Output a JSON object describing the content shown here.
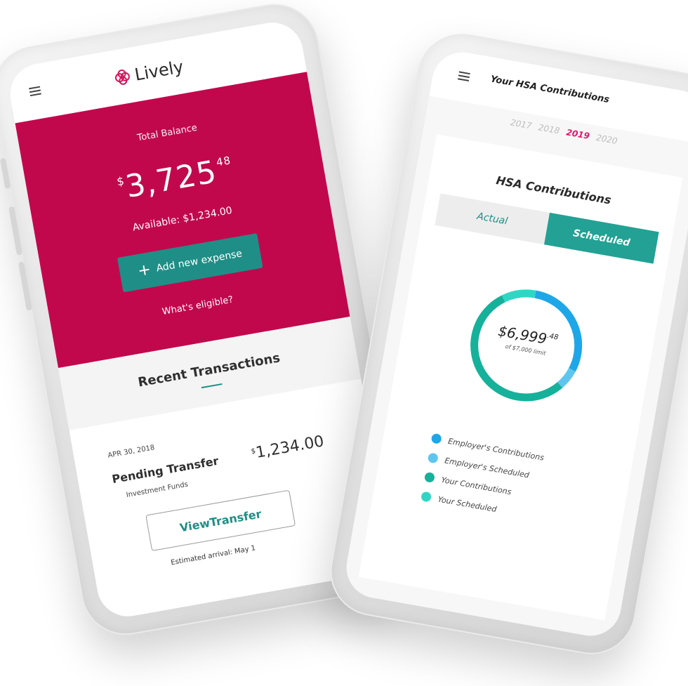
{
  "left_phone": {
    "logo_text": "Lively",
    "balance": {
      "label": "Total Balance",
      "currency": "$",
      "amount": "3,725",
      "cents": "48",
      "available": "Available: $1,234.00"
    },
    "add_expense_label": "Add new expense",
    "eligible_link": "What's eligible?",
    "recent_title": "Recent Transactions",
    "transaction": {
      "date": "APR 30, 2018",
      "name": "Pending Transfer",
      "sub": "Investment Funds",
      "currency": "$",
      "amount": "1,234.00",
      "button": "ViewTransfer",
      "eta": "Estimated arrival: May 1"
    }
  },
  "right_phone": {
    "title": "Your HSA Contributions",
    "years": [
      "2017",
      "2018",
      "2019",
      "2020"
    ],
    "active_year": "2019",
    "card_title": "HSA Contributions",
    "toggle": {
      "actual": "Actual",
      "scheduled": "Scheduled",
      "selected": "Scheduled"
    },
    "total": {
      "amount": "$6,999",
      "cents": ".48",
      "limit": "of $7,000 limit"
    },
    "donut_segments": [
      {
        "name": "Employer's Contributions",
        "fraction": 0.3,
        "color": "#1ea7e8"
      },
      {
        "name": "Employer's Scheduled",
        "fraction": 0.06,
        "color": "#5ec6ee"
      },
      {
        "name": "Your Contributions",
        "fraction": 0.54,
        "color": "#16b19a"
      },
      {
        "name": "Your Scheduled",
        "fraction": 0.1,
        "color": "#2fd6c4"
      }
    ],
    "legend": [
      {
        "label": "Employer's Contributions",
        "color": "#1ea7e8"
      },
      {
        "label": "Employer's Scheduled",
        "color": "#5ec6ee"
      },
      {
        "label": "Your Contributions",
        "color": "#16b19a"
      },
      {
        "label": "Your Scheduled",
        "color": "#2fd6c4"
      }
    ]
  },
  "colors": {
    "brand_pink": "#c2084d",
    "teal": "#1f8e86",
    "teal_light": "#22a194"
  }
}
